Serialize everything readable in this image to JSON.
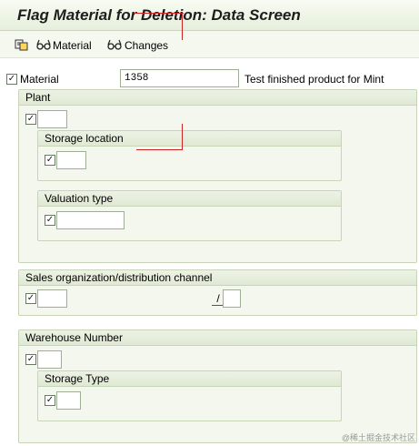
{
  "title": "Flag Material for Deletion: Data Screen",
  "toolbar": {
    "material_label": "Material",
    "changes_label": "Changes"
  },
  "material": {
    "label": "Material",
    "value": "1358",
    "description": "Test finished product for Mint",
    "checked": "✓"
  },
  "plant": {
    "header": "Plant",
    "checked": "✓",
    "value": "",
    "storage_location": {
      "header": "Storage location",
      "checked": "✓",
      "value": ""
    },
    "valuation_type": {
      "header": "Valuation type",
      "checked": "✓",
      "value": ""
    }
  },
  "sales": {
    "header": "Sales organization/distribution channel",
    "checked": "✓",
    "sales_org_value": "",
    "separator": "/",
    "dist_channel_value": ""
  },
  "warehouse": {
    "header": "Warehouse Number",
    "checked": "✓",
    "value": "",
    "storage_type": {
      "header": "Storage Type",
      "checked": "✓",
      "value": ""
    }
  },
  "watermark": "@稀土掘金技术社区",
  "colors": {
    "header_bg": "#e6efdc",
    "group_bg": "#f3f7ed",
    "border": "#c7d4b8",
    "annotation_red": "#cc2222"
  }
}
